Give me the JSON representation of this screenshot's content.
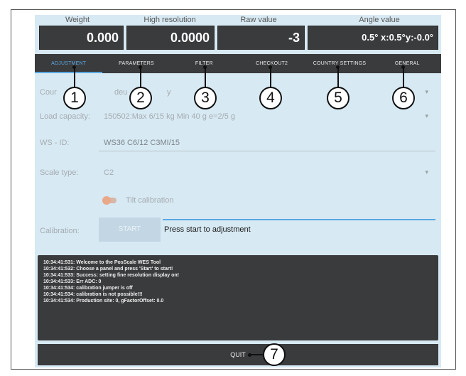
{
  "readouts": {
    "labels": [
      "Weight",
      "High resolution",
      "Raw value",
      "Angle value"
    ],
    "weight": "0.000",
    "high_resolution": "0.0000",
    "raw_value": "-3",
    "angle_value": "0.5° x:0.5°y:-0.0°"
  },
  "tabs": [
    {
      "label": "ADJUSTMENT",
      "active": true
    },
    {
      "label": "PARAMETERS",
      "active": false
    },
    {
      "label": "FILTER",
      "active": false
    },
    {
      "label": "CHECKOUT2",
      "active": false
    },
    {
      "label": "COUNTRY SETTINGS",
      "active": false
    },
    {
      "label": "GENERAL",
      "active": false
    }
  ],
  "form": {
    "country_label": "Cour",
    "country_value": "deu",
    "country_value_tail": "y",
    "load_capacity_label": "Load capacity:",
    "load_capacity_value": "150502:Max 6/15 kg   Min 40 g   e=2/5 g",
    "ws_id_label": "WS - ID:",
    "ws_id_value": "WS36 C6/12 C3MI/15",
    "scale_type_label": "Scale type:",
    "scale_type_value": "C2",
    "dropdown_arrow": "▾",
    "tilt_label": "Tilt calibration",
    "calibration_label": "Calibration:",
    "start_label": "START",
    "calibration_message": "Press start to adjustment"
  },
  "log": [
    "10:34:41:531: Welcome to the PosScale WES Tool",
    "10:34:41:532: Choose a panel and press 'Start' to start!",
    "10:34:41:533: Success: setting fine resolution display on!",
    "10:34:41:533: Err ADC: 0",
    "10:34:41:534: calibration jumper is off",
    "10:34:41:534: calibration is not possible!!!",
    "10:34:41:534: Production site: 0, gFactorOffset: 0.0"
  ],
  "quit_label": "QUIT",
  "callouts": [
    "1",
    "2",
    "3",
    "4",
    "5",
    "6",
    "7"
  ],
  "colors": {
    "panel_bg": "#d7e9f3",
    "dark": "#3a3b3d",
    "accent": "#5aa7e0"
  }
}
